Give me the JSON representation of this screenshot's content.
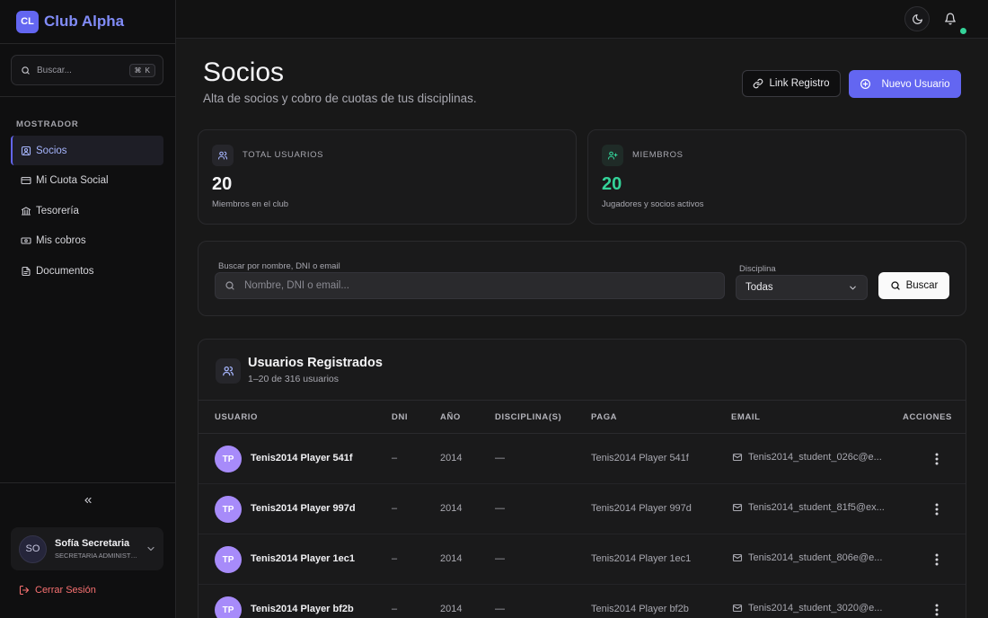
{
  "brand": {
    "logo": "CL",
    "name": "Club Alpha",
    "color": "#6366f1"
  },
  "sidebar": {
    "search_placeholder": "Buscar...",
    "search_shortcut": "⌘ K",
    "section_title": "MOSTRADOR",
    "items": [
      {
        "label": "Socios",
        "icon": "user-square-icon",
        "active": true
      },
      {
        "label": "Mi Cuota Social",
        "icon": "credit-card-icon",
        "active": false
      },
      {
        "label": "Tesorería",
        "icon": "bank-icon",
        "active": false
      },
      {
        "label": "Mis cobros",
        "icon": "banknote-icon",
        "active": false
      },
      {
        "label": "Documentos",
        "icon": "file-icon",
        "active": false
      }
    ],
    "user": {
      "initials": "SO",
      "name": "Sofía Secretaria",
      "role": "SECRETARIA ADMINISTRATIVA"
    },
    "logout_label": "Cerrar Sesión"
  },
  "topbar": {
    "theme_icon": "moon-icon",
    "notification_icon": "bell-icon"
  },
  "page": {
    "title": "Socios",
    "subtitle": "Alta de socios y cobro de cuotas de tus disciplinas.",
    "link_button": "Link Registro",
    "new_button": "Nuevo Usuario"
  },
  "stats": [
    {
      "label": "TOTAL USUARIOS",
      "value": "20",
      "note": "Miembros en el club",
      "accent": "#e8e8ea"
    },
    {
      "label": "MIEMBROS",
      "value": "20",
      "note": "Jugadores y socios activos",
      "accent": "#34d399"
    }
  ],
  "filters": {
    "search_label": "Buscar por nombre, DNI o email",
    "search_placeholder": "Nombre, DNI o email...",
    "discipline_label": "Disciplina",
    "discipline_value": "Todas",
    "search_button": "Buscar"
  },
  "table": {
    "title": "Usuarios Registrados",
    "subtitle": "1–20 de 316 usuarios",
    "columns": [
      "USUARIO",
      "DNI",
      "AÑO",
      "DISCIPLINA(S)",
      "PAGA",
      "EMAIL",
      "ACCIONES"
    ],
    "rows": [
      {
        "initials": "TP",
        "name": "Tenis2014 Player 541f",
        "dni": "–",
        "year": "2014",
        "disciplines": "—",
        "paga": "Tenis2014 Player 541f",
        "email": "Tenis2014_student_026c@e..."
      },
      {
        "initials": "TP",
        "name": "Tenis2014 Player 997d",
        "dni": "–",
        "year": "2014",
        "disciplines": "—",
        "paga": "Tenis2014 Player 997d",
        "email": "Tenis2014_student_81f5@ex..."
      },
      {
        "initials": "TP",
        "name": "Tenis2014 Player 1ec1",
        "dni": "–",
        "year": "2014",
        "disciplines": "—",
        "paga": "Tenis2014 Player 1ec1",
        "email": "Tenis2014_student_806e@e..."
      },
      {
        "initials": "TP",
        "name": "Tenis2014 Player bf2b",
        "dni": "–",
        "year": "2014",
        "disciplines": "—",
        "paga": "Tenis2014 Player bf2b",
        "email": "Tenis2014_student_3020@e..."
      }
    ]
  }
}
